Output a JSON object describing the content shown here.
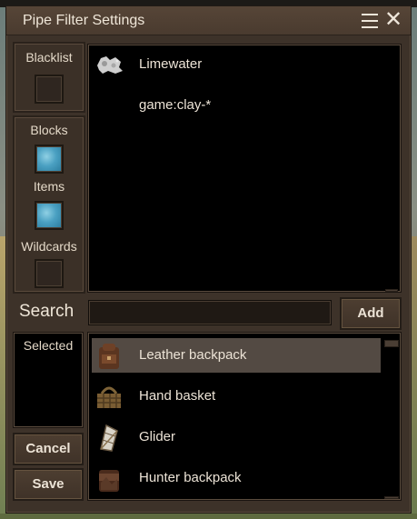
{
  "window": {
    "title": "Pipe Filter Settings"
  },
  "left_panel": {
    "blacklist_label": "Blacklist",
    "blacklist_checked": false,
    "blocks_label": "Blocks",
    "blocks_checked": true,
    "items_label": "Items",
    "items_checked": true,
    "wildcards_label": "Wildcards",
    "wildcards_checked": false
  },
  "filter_list": [
    {
      "label": "Limewater",
      "icon": "limewater-icon"
    },
    {
      "label": "game:clay-*",
      "icon": ""
    }
  ],
  "search": {
    "label": "Search",
    "value": "",
    "placeholder": "",
    "add_label": "Add"
  },
  "selected_panel": {
    "label": "Selected"
  },
  "results_list": [
    {
      "label": "Leather backpack",
      "icon": "leather-backpack-icon",
      "selected": true
    },
    {
      "label": "Hand basket",
      "icon": "hand-basket-icon",
      "selected": false
    },
    {
      "label": "Glider",
      "icon": "glider-icon",
      "selected": false
    },
    {
      "label": "Hunter backpack",
      "icon": "hunter-backpack-icon",
      "selected": false
    }
  ],
  "buttons": {
    "cancel_label": "Cancel",
    "save_label": "Save"
  }
}
